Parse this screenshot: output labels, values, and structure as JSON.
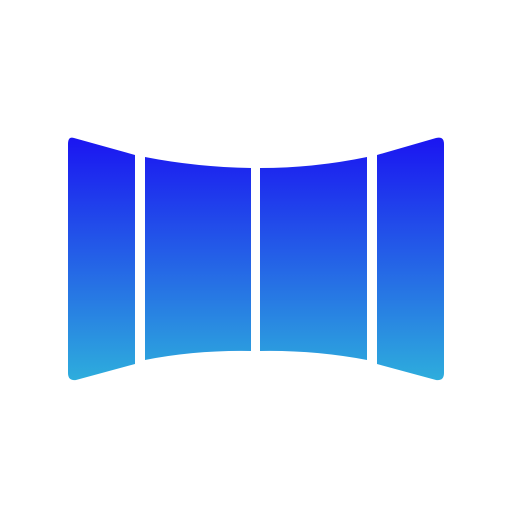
{
  "icon": {
    "name": "panorama-app-icon",
    "panel_count": 4
  },
  "colors": {
    "background": "#ffffff",
    "gradient_top": "#1a10f2",
    "gradient_bottom": "#2eb0dc"
  }
}
